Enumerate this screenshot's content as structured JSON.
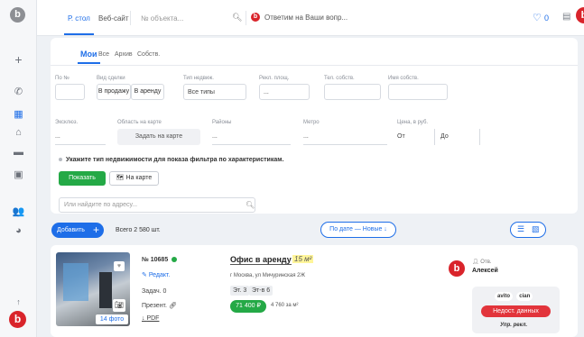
{
  "sidebar": {
    "logo": "b",
    "icons": [
      "plus-icon",
      "phone-icon",
      "building-icon",
      "house-icon",
      "folder-icon",
      "briefcase-icon",
      "users-icon",
      "pie-chart-icon",
      "arrow-up-icon"
    ],
    "bottom_logo": "b"
  },
  "topbar": {
    "tabs": [
      {
        "label": "Р. стол",
        "active": true
      },
      {
        "label": "Веб-сайт",
        "active": false
      }
    ],
    "search_placeholder": "№ объекта...",
    "answers_label": "Ответим на Ваши вопр...",
    "favorites_count": "0",
    "logo": "b"
  },
  "filter": {
    "tabs": [
      {
        "label": "Мои",
        "active": true
      },
      {
        "label": "Все",
        "active": false
      },
      {
        "label": "Архив",
        "active": false
      },
      {
        "label": "Собств.",
        "active": false
      }
    ],
    "labels": {
      "number": "По №",
      "deal_type": "Вид сделки",
      "property_type": "Тип недвиж.",
      "rec_area": "Рекл. площ.",
      "owner_phone": "Тел. собств.",
      "owner_name": "Имя собств.",
      "exclusive": "Эксклюз.",
      "map_area": "Область на карте",
      "districts": "Районы",
      "metro": "Метро",
      "price": "Цена, в руб."
    },
    "deal_options": [
      "В продажу",
      "В аренду"
    ],
    "property_value": "Все типы",
    "rec_area_value": "...",
    "exclusive_value": "...",
    "map_button": "Задать на карте",
    "districts_value": "...",
    "metro_value": "...",
    "price_from": "От",
    "price_to": "До",
    "hint": "Укажите тип недвижимости для показа фильтра по характеристикам.",
    "show_button": "Показать",
    "on_map_button": "На карте",
    "address_placeholder": "Или найдите по адресу..."
  },
  "toolbar": {
    "add_button": "Добавить",
    "total": "Всего 2 580 шт.",
    "sort_button": "По дате — Новые ↓"
  },
  "listing": {
    "id": "№ 10685",
    "edit": "Редакт.",
    "task": "Задач. 0",
    "presentation": "Презент.",
    "pdf": "PDF",
    "photo_count": "14 фото",
    "title": "Офис в аренду",
    "area": "15 м²",
    "address": "г Москва, ул Мичуринская 2Ж",
    "floor": "Эт. 3",
    "floors_total": "Эт-в 6",
    "price": "71 400 ₽",
    "price_per_m2": "4 760 за м²",
    "owner_role": "Отв.",
    "owner_name": "Алексей",
    "tags": [
      "avito",
      "cian"
    ],
    "status_badge": "Недост. данных",
    "management": "Упр. рекл."
  }
}
